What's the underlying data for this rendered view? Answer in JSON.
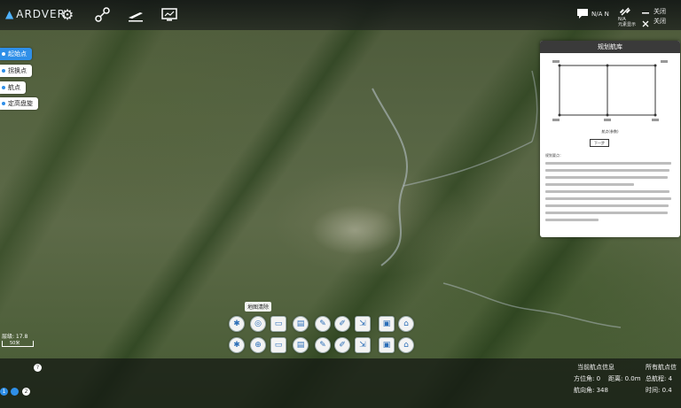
{
  "app": {
    "brand": "ARDVER"
  },
  "topbar": {
    "icons": [
      "gear-icon",
      "route-icon",
      "takeoff-icon",
      "monitor-icon"
    ],
    "right": {
      "item1": "N/A N",
      "item2": "N/A",
      "item3": "关闭",
      "item3b": "关闭",
      "item2b": "元素显示"
    }
  },
  "left_menu": [
    {
      "label": "起始点",
      "active": true
    },
    {
      "label": "拐换点",
      "active": false
    },
    {
      "label": "航点",
      "active": false
    },
    {
      "label": "定高盘旋",
      "active": false
    }
  ],
  "panel": {
    "title": "规划航库",
    "diagram_label": "航点(参数)",
    "button_label": "下一步",
    "notes_title": "规划要点："
  },
  "toolbar": {
    "tooltip": "地图清除",
    "row1": [
      "grid-icon",
      "draw-icon",
      "ruler-icon",
      "delete-icon",
      "edit-icon",
      "edit-square-icon",
      "export-icon",
      "save-icon",
      "basket-icon"
    ],
    "row2": [
      "grid-icon",
      "compass-icon",
      "ruler-icon",
      "delete-icon",
      "edit-icon",
      "edit-square-icon",
      "export-icon",
      "save-icon",
      "basket-icon"
    ]
  },
  "scale": {
    "zoom_label": "层级: 17.8",
    "scale_value": "50米"
  },
  "bottom": {
    "current_title": "当前航点信息",
    "all_title": "所有航点信",
    "bearing": "方位角: 0",
    "distance": "距离: 0.0m",
    "total": "总航程: 4",
    "heading": "航向角: 348",
    "time": "时间: 0.4",
    "pages": [
      "1",
      "2"
    ],
    "help": "?"
  },
  "colors": {
    "accent": "#2f8fe8",
    "panel_header": "#3a3a3a"
  }
}
